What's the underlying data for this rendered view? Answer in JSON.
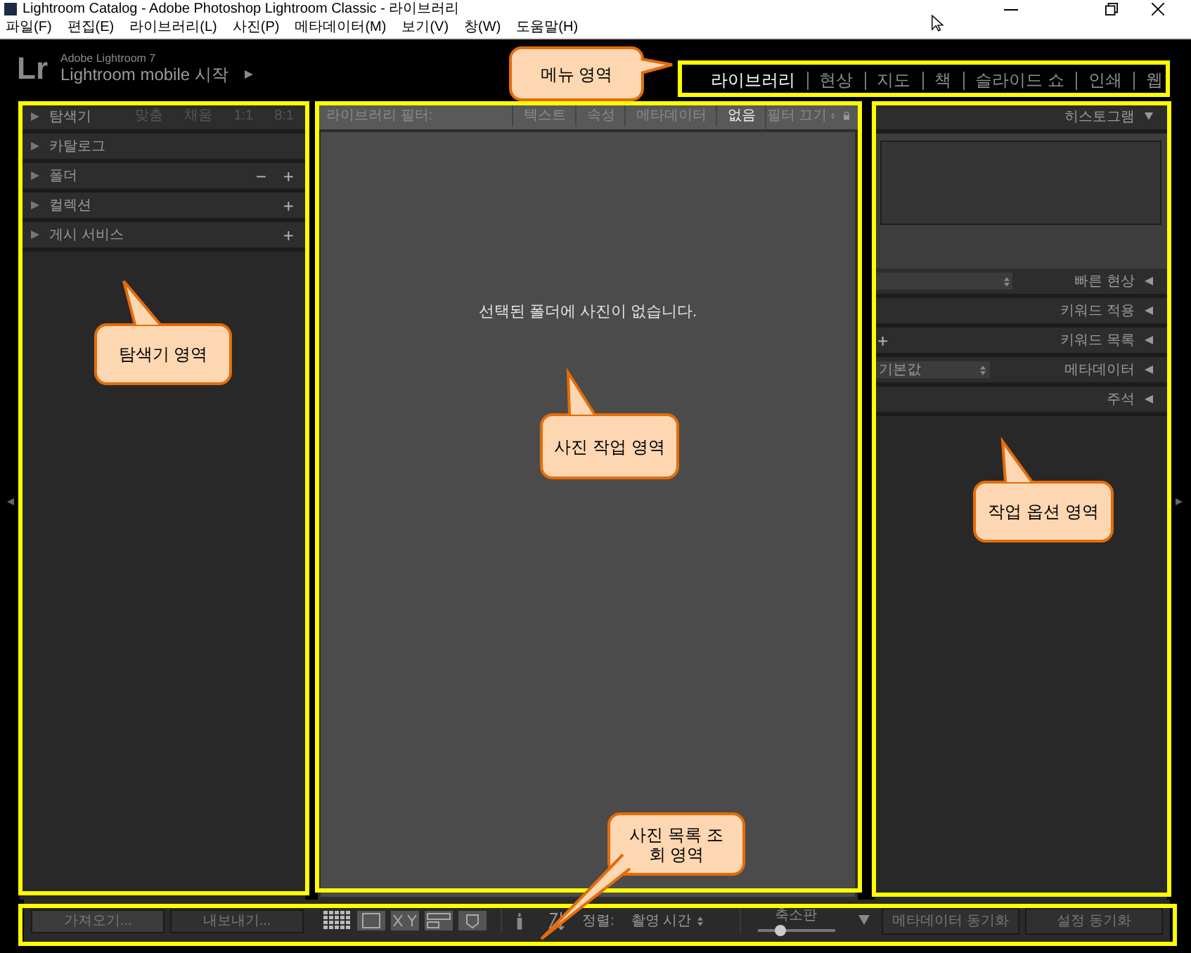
{
  "window": {
    "title": "Lightroom Catalog - Adobe Photoshop Lightroom Classic - 라이브러리"
  },
  "menu_bar": [
    "파일(F)",
    "편집(E)",
    "라이브러리(L)",
    "사진(P)",
    "메타데이터(M)",
    "보기(V)",
    "창(W)",
    "도움말(H)"
  ],
  "identity_plate": {
    "logo": "Lr",
    "version": "Adobe Lightroom 7",
    "mobile_link": "Lightroom mobile 시작"
  },
  "modules": [
    {
      "label": "라이브러리",
      "selected": true
    },
    {
      "label": "현상",
      "selected": false
    },
    {
      "label": "지도",
      "selected": false
    },
    {
      "label": "책",
      "selected": false
    },
    {
      "label": "슬라이드 쇼",
      "selected": false
    },
    {
      "label": "인쇄",
      "selected": false
    },
    {
      "label": "웹",
      "selected": false
    }
  ],
  "left_panels": [
    {
      "title": "탐색기",
      "expanded": false,
      "actions": [
        "맞춤",
        "채움",
        "1:1",
        "8:1"
      ]
    },
    {
      "title": "카탈로그",
      "expanded": false
    },
    {
      "title": "폴더",
      "expanded": false,
      "actions": [
        "−",
        "+"
      ]
    },
    {
      "title": "컬렉션",
      "expanded": false,
      "actions": [
        "+"
      ]
    },
    {
      "title": "게시 서비스",
      "expanded": false,
      "actions": [
        "+"
      ]
    }
  ],
  "library_filter": {
    "label": "라이브러리 필터:",
    "options": [
      {
        "label": "텍스트",
        "selected": false
      },
      {
        "label": "속성",
        "selected": false
      },
      {
        "label": "메타데이터",
        "selected": false
      },
      {
        "label": "없음",
        "selected": true
      }
    ],
    "preset": "필터 끄기"
  },
  "grid": {
    "message": "선택된 폴더에 사진이 없습니다."
  },
  "right_panels": [
    {
      "title": "히스토그램",
      "expanded": true,
      "kind": "histogram"
    },
    {
      "title": "빠른 현상",
      "expanded": false,
      "kind": "dropdown"
    },
    {
      "title": "키워드 적용",
      "expanded": false,
      "kind": "plain"
    },
    {
      "title": "키워드 목록",
      "expanded": false,
      "kind": "add",
      "action": "+"
    },
    {
      "title": "메타데이터",
      "expanded": false,
      "kind": "preset",
      "preset": "기본값"
    },
    {
      "title": "주석",
      "expanded": false,
      "kind": "plain"
    }
  ],
  "toolbar": {
    "import": "가져오기...",
    "export": "내보내기...",
    "sort_label": "정렬:",
    "sort_value": "촬영 시간",
    "thumbnail_label": "축소판",
    "thumbnail": {
      "level": 0.3
    },
    "sync_metadata": "메타데이터 동기화",
    "sync_settings": "설정 동기화"
  },
  "annotations": [
    {
      "text": "메뉴 영역"
    },
    {
      "text": "탐색기 영역"
    },
    {
      "text": "사진 작업 영역"
    },
    {
      "text": "작업 옵션 영역"
    },
    {
      "text": "사진 목록 조회 영역"
    }
  ]
}
